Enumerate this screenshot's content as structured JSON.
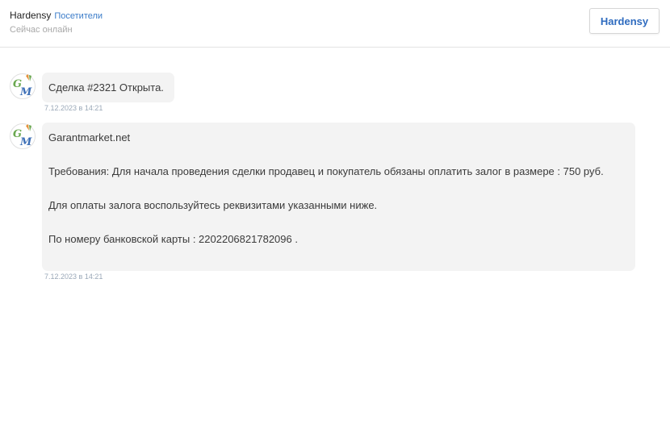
{
  "header": {
    "name": "Hardensy",
    "link": "Посетители",
    "status": "Сейчас онлайн",
    "button_label": "Hardensy"
  },
  "avatar": {
    "letters_top": "G",
    "letters_bottom": "M",
    "colors": {
      "green": "#6aa84f",
      "orange": "#e69138",
      "blue": "#3d6fb6"
    }
  },
  "messages": [
    {
      "paragraphs": [
        "Сделка #2321 Открыта."
      ],
      "time": "7.12.2023 в 14:21"
    },
    {
      "paragraphs": [
        "Garantmarket.net",
        "Требования: Для начала проведения сделки продавец и покупатель обязаны оплатить залог в размере : 750 руб.",
        "Для оплаты залога воспользуйтесь реквизитами указанными ниже.",
        "По номеру банковской карты : 2202206821782096 ."
      ],
      "time": "7.12.2023 в 14:21"
    }
  ]
}
